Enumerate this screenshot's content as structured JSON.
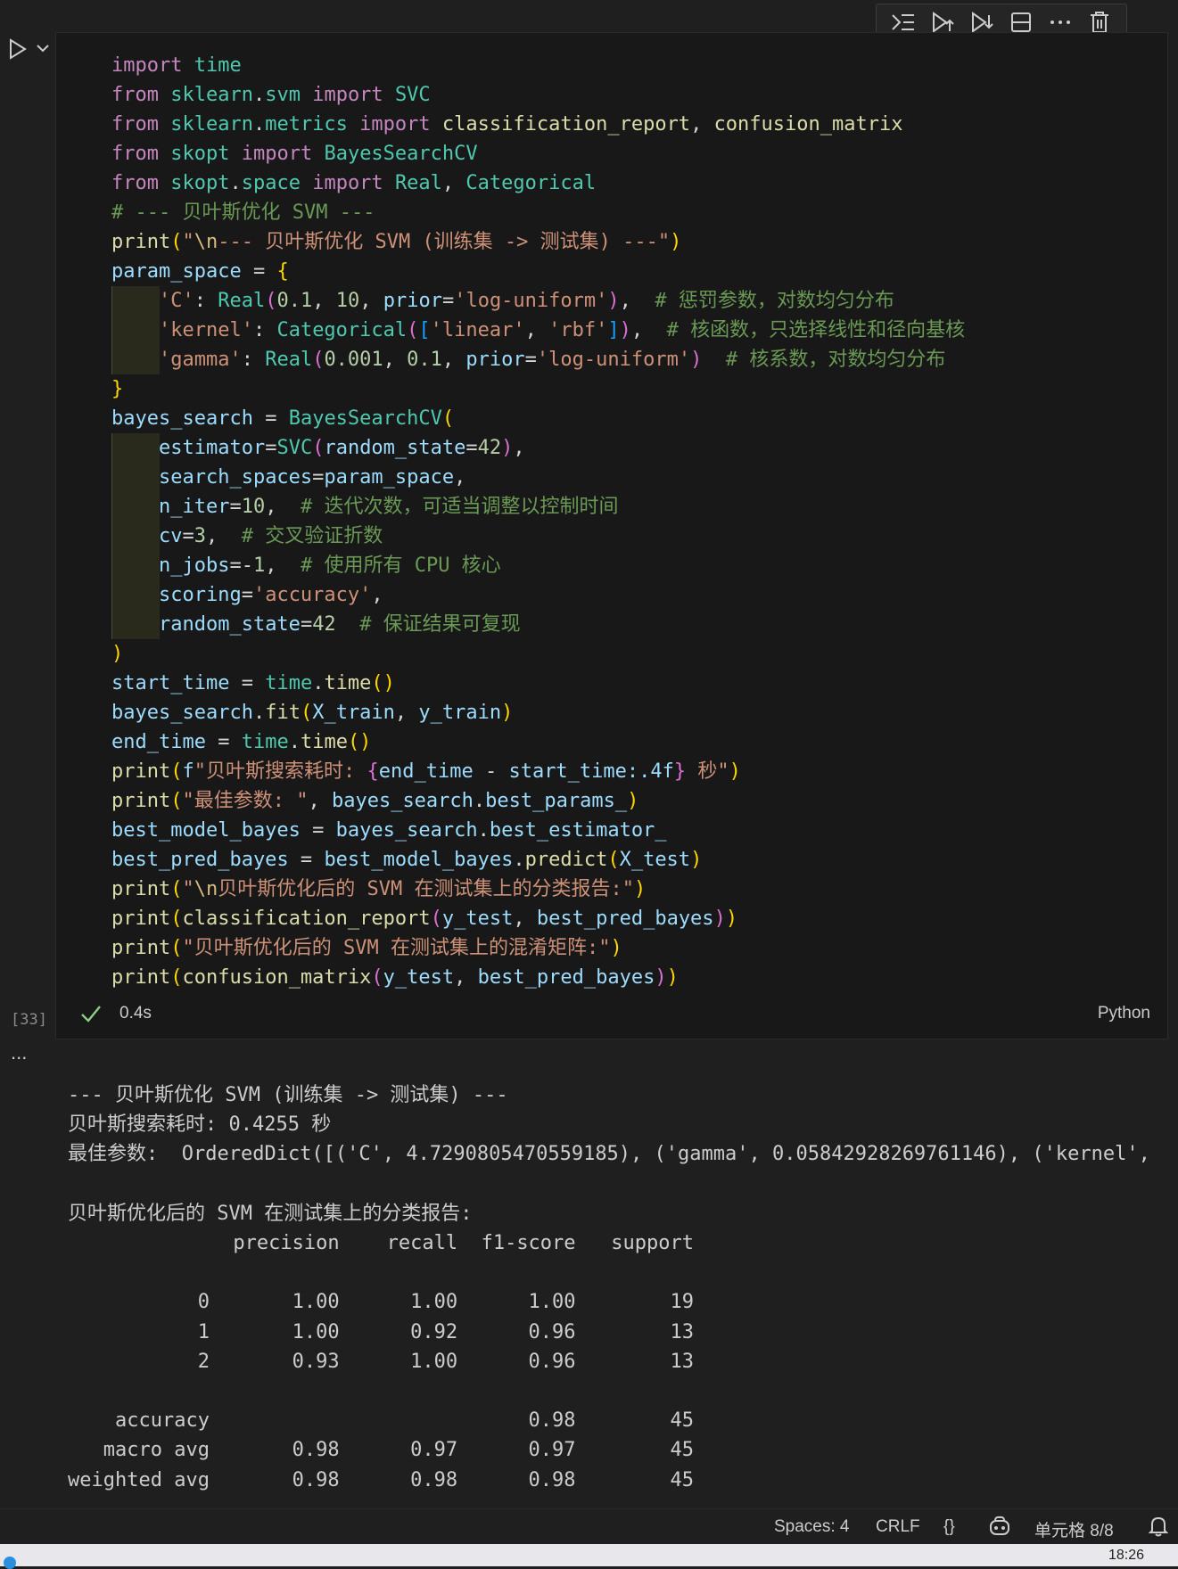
{
  "cell": {
    "execution_count": "[33]",
    "exec_time": "0.4s",
    "language": "Python",
    "code_lines": [
      [
        [
          "kw",
          "import"
        ],
        [
          "op",
          " "
        ],
        [
          "mod",
          "time"
        ]
      ],
      [
        [
          "kw",
          "from"
        ],
        [
          "op",
          " "
        ],
        [
          "mod",
          "sklearn"
        ],
        [
          "op",
          "."
        ],
        [
          "mod",
          "svm"
        ],
        [
          "op",
          " "
        ],
        [
          "kw",
          "import"
        ],
        [
          "op",
          " "
        ],
        [
          "mod",
          "SVC"
        ]
      ],
      [
        [
          "kw",
          "from"
        ],
        [
          "op",
          " "
        ],
        [
          "mod",
          "sklearn"
        ],
        [
          "op",
          "."
        ],
        [
          "mod",
          "metrics"
        ],
        [
          "op",
          " "
        ],
        [
          "kw",
          "import"
        ],
        [
          "op",
          " "
        ],
        [
          "fn",
          "classification_report"
        ],
        [
          "op",
          ", "
        ],
        [
          "fn",
          "confusion_matrix"
        ]
      ],
      [
        [
          "kw",
          "from"
        ],
        [
          "op",
          " "
        ],
        [
          "mod",
          "skopt"
        ],
        [
          "op",
          " "
        ],
        [
          "kw",
          "import"
        ],
        [
          "op",
          " "
        ],
        [
          "mod",
          "BayesSearchCV"
        ]
      ],
      [
        [
          "kw",
          "from"
        ],
        [
          "op",
          " "
        ],
        [
          "mod",
          "skopt"
        ],
        [
          "op",
          "."
        ],
        [
          "mod",
          "space"
        ],
        [
          "op",
          " "
        ],
        [
          "kw",
          "import"
        ],
        [
          "op",
          " "
        ],
        [
          "mod",
          "Real"
        ],
        [
          "op",
          ", "
        ],
        [
          "mod",
          "Categorical"
        ]
      ],
      [
        [
          "cmt",
          "# --- 贝叶斯优化 SVM ---"
        ]
      ],
      [
        [
          "fn",
          "print"
        ],
        [
          "br1",
          "("
        ],
        [
          "str",
          "\""
        ],
        [
          "esc",
          "\\n"
        ],
        [
          "str",
          "--- 贝叶斯优化 SVM (训练集 -> 测试集) ---\""
        ],
        [
          "br1",
          ")"
        ]
      ],
      [
        [
          "var",
          "param_space"
        ],
        [
          "op",
          " = "
        ],
        [
          "br1",
          "{"
        ]
      ],
      [
        [
          "op",
          "    "
        ],
        [
          "str",
          "'C'"
        ],
        [
          "op",
          ": "
        ],
        [
          "mod",
          "Real"
        ],
        [
          "br2",
          "("
        ],
        [
          "num",
          "0.1"
        ],
        [
          "op",
          ", "
        ],
        [
          "num",
          "10"
        ],
        [
          "op",
          ", "
        ],
        [
          "var",
          "prior"
        ],
        [
          "op",
          "="
        ],
        [
          "str",
          "'log-uniform'"
        ],
        [
          "br2",
          ")"
        ],
        [
          "op",
          ",  "
        ],
        [
          "cmt",
          "# 惩罚参数，对数均匀分布"
        ]
      ],
      [
        [
          "op",
          "    "
        ],
        [
          "str",
          "'kernel'"
        ],
        [
          "op",
          ": "
        ],
        [
          "mod",
          "Categorical"
        ],
        [
          "br2",
          "("
        ],
        [
          "br3",
          "["
        ],
        [
          "str",
          "'linear'"
        ],
        [
          "op",
          ", "
        ],
        [
          "str",
          "'rbf'"
        ],
        [
          "br3",
          "]"
        ],
        [
          "br2",
          ")"
        ],
        [
          "op",
          ",  "
        ],
        [
          "cmt",
          "# 核函数，只选择线性和径向基核"
        ]
      ],
      [
        [
          "op",
          "    "
        ],
        [
          "str",
          "'gamma'"
        ],
        [
          "op",
          ": "
        ],
        [
          "mod",
          "Real"
        ],
        [
          "br2",
          "("
        ],
        [
          "num",
          "0.001"
        ],
        [
          "op",
          ", "
        ],
        [
          "num",
          "0.1"
        ],
        [
          "op",
          ", "
        ],
        [
          "var",
          "prior"
        ],
        [
          "op",
          "="
        ],
        [
          "str",
          "'log-uniform'"
        ],
        [
          "br2",
          ")"
        ],
        [
          "op",
          "  "
        ],
        [
          "cmt",
          "# 核系数，对数均匀分布"
        ]
      ],
      [
        [
          "br1",
          "}"
        ]
      ],
      [
        [
          "var",
          "bayes_search"
        ],
        [
          "op",
          " = "
        ],
        [
          "mod",
          "BayesSearchCV"
        ],
        [
          "br1",
          "("
        ]
      ],
      [
        [
          "op",
          "    "
        ],
        [
          "var",
          "estimator"
        ],
        [
          "op",
          "="
        ],
        [
          "mod",
          "SVC"
        ],
        [
          "br2",
          "("
        ],
        [
          "var",
          "random_state"
        ],
        [
          "op",
          "="
        ],
        [
          "num",
          "42"
        ],
        [
          "br2",
          ")"
        ],
        [
          "op",
          ","
        ]
      ],
      [
        [
          "op",
          "    "
        ],
        [
          "var",
          "search_spaces"
        ],
        [
          "op",
          "="
        ],
        [
          "var",
          "param_space"
        ],
        [
          "op",
          ","
        ]
      ],
      [
        [
          "op",
          "    "
        ],
        [
          "var",
          "n_iter"
        ],
        [
          "op",
          "="
        ],
        [
          "num",
          "10"
        ],
        [
          "op",
          ",  "
        ],
        [
          "cmt",
          "# 迭代次数，可适当调整以控制时间"
        ]
      ],
      [
        [
          "op",
          "    "
        ],
        [
          "var",
          "cv"
        ],
        [
          "op",
          "="
        ],
        [
          "num",
          "3"
        ],
        [
          "op",
          ",  "
        ],
        [
          "cmt",
          "# 交叉验证折数"
        ]
      ],
      [
        [
          "op",
          "    "
        ],
        [
          "var",
          "n_jobs"
        ],
        [
          "op",
          "=-"
        ],
        [
          "num",
          "1"
        ],
        [
          "op",
          ",  "
        ],
        [
          "cmt",
          "# 使用所有 CPU 核心"
        ]
      ],
      [
        [
          "op",
          "    "
        ],
        [
          "var",
          "scoring"
        ],
        [
          "op",
          "="
        ],
        [
          "str",
          "'accuracy'"
        ],
        [
          "op",
          ","
        ]
      ],
      [
        [
          "op",
          "    "
        ],
        [
          "var",
          "random_state"
        ],
        [
          "op",
          "="
        ],
        [
          "num",
          "42"
        ],
        [
          "op",
          "  "
        ],
        [
          "cmt",
          "# 保证结果可复现"
        ]
      ],
      [
        [
          "br1",
          ")"
        ]
      ],
      [
        [
          "var",
          "start_time"
        ],
        [
          "op",
          " = "
        ],
        [
          "mod",
          "time"
        ],
        [
          "op",
          "."
        ],
        [
          "fn",
          "time"
        ],
        [
          "br1",
          "()"
        ]
      ],
      [
        [
          "var",
          "bayes_search"
        ],
        [
          "op",
          "."
        ],
        [
          "fn",
          "fit"
        ],
        [
          "br1",
          "("
        ],
        [
          "var",
          "X_train"
        ],
        [
          "op",
          ", "
        ],
        [
          "var",
          "y_train"
        ],
        [
          "br1",
          ")"
        ]
      ],
      [
        [
          "var",
          "end_time"
        ],
        [
          "op",
          " = "
        ],
        [
          "mod",
          "time"
        ],
        [
          "op",
          "."
        ],
        [
          "fn",
          "time"
        ],
        [
          "br1",
          "()"
        ]
      ],
      [
        [
          "fn",
          "print"
        ],
        [
          "br1",
          "("
        ],
        [
          "var",
          "f"
        ],
        [
          "str",
          "\"贝叶斯搜索耗时: "
        ],
        [
          "br2",
          "{"
        ],
        [
          "var",
          "end_time"
        ],
        [
          "op",
          " - "
        ],
        [
          "var",
          "start_time"
        ],
        [
          "var",
          ":.4f"
        ],
        [
          "br2",
          "}"
        ],
        [
          "str",
          " 秒\""
        ],
        [
          "br1",
          ")"
        ]
      ],
      [
        [
          "fn",
          "print"
        ],
        [
          "br1",
          "("
        ],
        [
          "str",
          "\"最佳参数: \""
        ],
        [
          "op",
          ", "
        ],
        [
          "var",
          "bayes_search"
        ],
        [
          "op",
          "."
        ],
        [
          "var",
          "best_params_"
        ],
        [
          "br1",
          ")"
        ]
      ],
      [
        [
          "var",
          "best_model_bayes"
        ],
        [
          "op",
          " = "
        ],
        [
          "var",
          "bayes_search"
        ],
        [
          "op",
          "."
        ],
        [
          "var",
          "best_estimator_"
        ]
      ],
      [
        [
          "var",
          "best_pred_bayes"
        ],
        [
          "op",
          " = "
        ],
        [
          "var",
          "best_model_bayes"
        ],
        [
          "op",
          "."
        ],
        [
          "fn",
          "predict"
        ],
        [
          "br1",
          "("
        ],
        [
          "var",
          "X_test"
        ],
        [
          "br1",
          ")"
        ]
      ],
      [
        [
          "fn",
          "print"
        ],
        [
          "br1",
          "("
        ],
        [
          "str",
          "\""
        ],
        [
          "esc",
          "\\n"
        ],
        [
          "str",
          "贝叶斯优化后的 SVM 在测试集上的分类报告:\""
        ],
        [
          "br1",
          ")"
        ]
      ],
      [
        [
          "fn",
          "print"
        ],
        [
          "br1",
          "("
        ],
        [
          "fn",
          "classification_report"
        ],
        [
          "br2",
          "("
        ],
        [
          "var",
          "y_test"
        ],
        [
          "op",
          ", "
        ],
        [
          "var",
          "best_pred_bayes"
        ],
        [
          "br2",
          ")"
        ],
        [
          "br1",
          ")"
        ]
      ],
      [
        [
          "fn",
          "print"
        ],
        [
          "br1",
          "("
        ],
        [
          "str",
          "\"贝叶斯优化后的 SVM 在测试集上的混淆矩阵:\""
        ],
        [
          "br1",
          ")"
        ]
      ],
      [
        [
          "fn",
          "print"
        ],
        [
          "br1",
          "("
        ],
        [
          "fn",
          "confusion_matrix"
        ],
        [
          "br2",
          "("
        ],
        [
          "var",
          "y_test"
        ],
        [
          "op",
          ", "
        ],
        [
          "var",
          "best_pred_bayes"
        ],
        [
          "br2",
          ")"
        ],
        [
          "br1",
          ")"
        ]
      ]
    ]
  },
  "output": {
    "menu_glyph": "...",
    "lines": [
      "--- 贝叶斯优化 SVM (训练集 -> 测试集) ---",
      "贝叶斯搜索耗时: 0.4255 秒",
      "最佳参数:  OrderedDict([('C', 4.7290805470559185), ('gamma', 0.05842928269761146), ('kernel', ",
      "",
      "贝叶斯优化后的 SVM 在测试集上的分类报告:",
      "              precision    recall  f1-score   support",
      "",
      "           0       1.00      1.00      1.00        19",
      "           1       1.00      0.92      0.96        13",
      "           2       0.93      1.00      0.96        13",
      "",
      "    accuracy                           0.98        45",
      "   macro avg       0.98      0.97      0.97        45",
      "weighted avg       0.98      0.98      0.98        45"
    ]
  },
  "status_bar": {
    "spaces": "Spaces: 4",
    "eol": "CRLF",
    "braces": "{}",
    "cell_pos": "单元格 8/8"
  },
  "taskbar": {
    "time": "18:26"
  },
  "icons": {
    "run": "run-icon",
    "toolbar": [
      "run-by-line-icon",
      "execute-above-icon",
      "execute-below-icon",
      "split-cell-icon",
      "more-icon",
      "delete-icon"
    ],
    "check": "check-icon",
    "copilot": "copilot-icon",
    "bell": "bell-icon"
  }
}
